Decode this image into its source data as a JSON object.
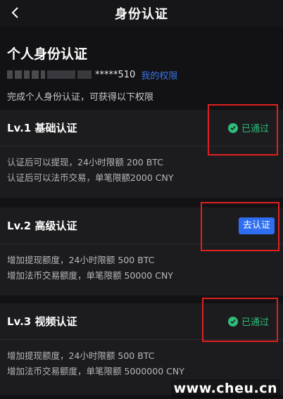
{
  "header": {
    "title": "身份认证",
    "back_icon": "chevron-left-icon"
  },
  "personal": {
    "title": "个人身份认证",
    "masked_id": "*****510",
    "rights_link": "我的权限",
    "hint": "完成个人身份认证，可获得以下权限"
  },
  "cards": [
    {
      "title": "Lv.1 基础认证",
      "status": "已通过",
      "lines": [
        "认证后可以提现，24小时限额 200 BTC",
        "认证后可以法币交易，单笔限额2000 CNY"
      ]
    },
    {
      "title": "Lv.2 高级认证",
      "button": "去认证",
      "lines": [
        "增加提现额度，24小时限额 500 BTC",
        "增加法币交易额度，单笔限额 50000 CNY"
      ]
    },
    {
      "title": "Lv.3 视频认证",
      "status": "已通过",
      "lines": [
        "增加提现额度，24小时限额 500 BTC",
        "增加法币交易额度，单笔限额 5000000 CNY"
      ]
    }
  ],
  "watermark": "www.cheu.cn",
  "colors": {
    "background": "#121214",
    "card": "#1c1c1f",
    "passed": "#2fbd7a",
    "link": "#3a74e8",
    "button": "#2e6ef0",
    "highlight": "#e02020"
  }
}
